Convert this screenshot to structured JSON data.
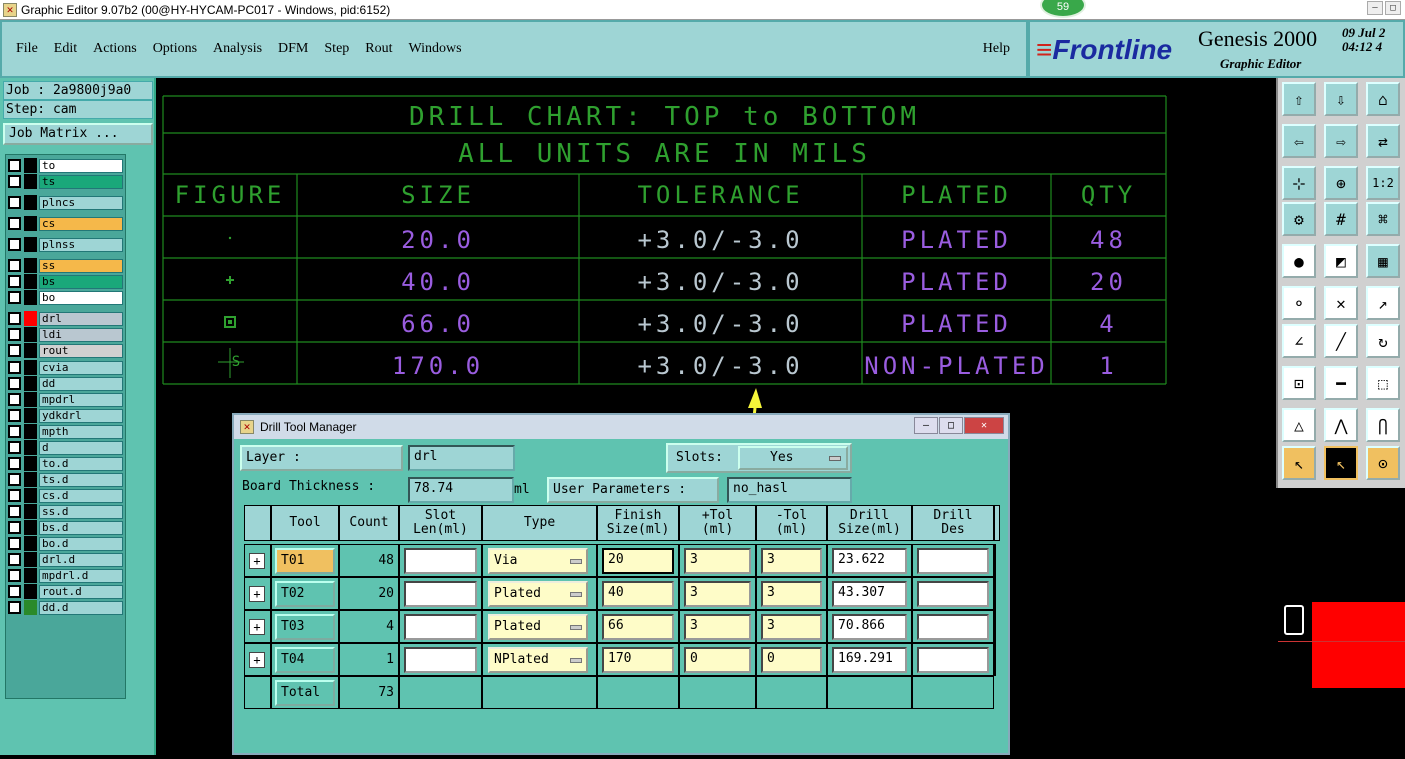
{
  "window": {
    "title": "Graphic Editor 9.07b2 (00@HY-HYCAM-PC017 - Windows, pid:6152)",
    "badge": "59"
  },
  "menu": {
    "items": [
      "File",
      "Edit",
      "Actions",
      "Options",
      "Analysis",
      "DFM",
      "Step",
      "Rout",
      "Windows"
    ],
    "help": "Help"
  },
  "brand": {
    "logo": "Frontline",
    "product": "Genesis 2000",
    "subtitle": "Graphic Editor",
    "date_line1": "09 Jul 2",
    "date_line2": "04:12 4"
  },
  "left": {
    "job": "Job : 2a9800j9a0",
    "step": "Step: cam",
    "job_matrix": "Job Matrix ...",
    "layers": [
      {
        "name": "to",
        "color": "#ffffff"
      },
      {
        "name": "ts",
        "color": "#1aa87a"
      },
      {
        "name": "plncs",
        "color": "#9ed5d5"
      },
      {
        "name": "cs",
        "color": "#f5b84a"
      },
      {
        "name": "plnss",
        "color": "#9ed5d5"
      },
      {
        "name": "ss",
        "color": "#f5b84a"
      },
      {
        "name": "bs",
        "color": "#1aa87a"
      },
      {
        "name": "bo",
        "color": "#ffffff"
      },
      {
        "name": "drl",
        "color": "#b9c7d0"
      },
      {
        "name": "ldi",
        "color": "#b9c7d0"
      },
      {
        "name": "rout",
        "color": "#d0d0d0"
      },
      {
        "name": "cvia",
        "color": "#9ed5d5"
      },
      {
        "name": "dd",
        "color": "#9ed5d5"
      },
      {
        "name": "mpdrl",
        "color": "#9ed5d5"
      },
      {
        "name": "ydkdrl",
        "color": "#9ed5d5"
      },
      {
        "name": "mpth",
        "color": "#9ed5d5"
      },
      {
        "name": "d",
        "color": "#9ed5d5"
      },
      {
        "name": "to.d",
        "color": "#9ed5d5"
      },
      {
        "name": "ts.d",
        "color": "#9ed5d5"
      },
      {
        "name": "cs.d",
        "color": "#9ed5d5"
      },
      {
        "name": "ss.d",
        "color": "#9ed5d5"
      },
      {
        "name": "bs.d",
        "color": "#9ed5d5"
      },
      {
        "name": "bo.d",
        "color": "#9ed5d5"
      },
      {
        "name": "drl.d",
        "color": "#9ed5d5"
      },
      {
        "name": "mpdrl.d",
        "color": "#9ed5d5"
      },
      {
        "name": "rout.d",
        "color": "#9ed5d5"
      },
      {
        "name": "dd.d",
        "color": "#9ed5d5"
      }
    ]
  },
  "chart": {
    "title": "DRILL CHART: TOP to BOTTOM",
    "subtitle": "ALL UNITS ARE IN MILS",
    "headers": [
      "FIGURE",
      "SIZE",
      "TOLERANCE",
      "PLATED",
      "QTY"
    ],
    "rows": [
      {
        "size": "20.0",
        "tol": "+3.0/-3.0",
        "plated": "PLATED",
        "qty": "48"
      },
      {
        "size": "40.0",
        "tol": "+3.0/-3.0",
        "plated": "PLATED",
        "qty": "20"
      },
      {
        "size": "66.0",
        "tol": "+3.0/-3.0",
        "plated": "PLATED",
        "qty": "4"
      },
      {
        "size": "170.0",
        "tol": "+3.0/-3.0",
        "plated": "NON-PLATED",
        "qty": "1"
      }
    ],
    "figure_label": "S",
    "line_color": "#1f8a1f",
    "header_color": "#2fa02f",
    "value_color": "#9a5de0"
  },
  "dialog": {
    "title": "Drill Tool Manager",
    "layer_label": "Layer         :",
    "layer_value": "drl",
    "slots_label": "Slots:",
    "slots_value": "Yes",
    "board_label": "Board Thickness :",
    "board_value": "78.74",
    "board_unit": "ml",
    "user_label": "User Parameters :",
    "user_value": "no_hasl",
    "headers": [
      "Tool",
      "Count",
      "Slot\nLen(ml)",
      "Type",
      "Finish\nSize(ml)",
      "+Tol\n(ml)",
      "-Tol\n(ml)",
      "Drill\nSize(ml)",
      "Drill\nDes"
    ],
    "tools": [
      {
        "tool": "T01",
        "count": "48",
        "type": "Via",
        "finish": "20",
        "ptol": "3",
        "mtol": "3",
        "drill": "23.622"
      },
      {
        "tool": "T02",
        "count": "20",
        "type": "Plated",
        "finish": "40",
        "ptol": "3",
        "mtol": "3",
        "drill": "43.307"
      },
      {
        "tool": "T03",
        "count": "4",
        "type": "Plated",
        "finish": "66",
        "ptol": "3",
        "mtol": "3",
        "drill": "70.866"
      },
      {
        "tool": "T04",
        "count": "1",
        "type": "NPlated",
        "finish": "170",
        "ptol": "0",
        "mtol": "0",
        "drill": "169.291"
      }
    ],
    "total_label": "Total",
    "total_count": "73"
  }
}
